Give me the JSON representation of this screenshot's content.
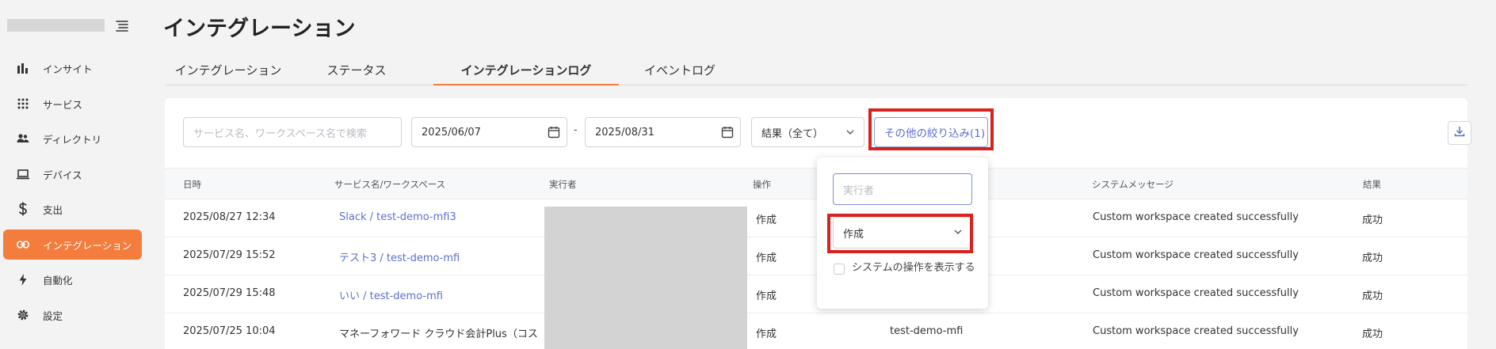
{
  "sidebar": {
    "items": [
      {
        "label": "インサイト",
        "icon": "bar-chart-icon"
      },
      {
        "label": "サービス",
        "icon": "grid-icon"
      },
      {
        "label": "ディレクトリ",
        "icon": "users-icon"
      },
      {
        "label": "デバイス",
        "icon": "laptop-icon"
      },
      {
        "label": "支出",
        "icon": "dollar-icon"
      },
      {
        "label": "インテグレーション",
        "icon": "link-icon"
      },
      {
        "label": "自動化",
        "icon": "lightning-icon"
      },
      {
        "label": "設定",
        "icon": "gear-icon"
      }
    ],
    "active_index": 5
  },
  "page": {
    "title": "インテグレーション"
  },
  "tabs": [
    {
      "label": "インテグレーション"
    },
    {
      "label": "ステータス"
    },
    {
      "label": "インテグレーションログ"
    },
    {
      "label": "イベントログ"
    }
  ],
  "active_tab": 2,
  "filters": {
    "search_placeholder": "サービス名、ワークスペース名で検索",
    "date_from": "2025/06/07",
    "date_separator": "-",
    "date_to": "2025/08/31",
    "result_select": "結果（全て）",
    "more_filters": "その他の絞り込み(1)"
  },
  "table": {
    "headers": {
      "datetime": "日時",
      "service": "サービス名/ワークスペース",
      "executor": "実行者",
      "operation": "操作",
      "message": "システムメッセージ",
      "result": "結果"
    },
    "rows": [
      {
        "datetime": "2025/08/27 12:34",
        "service": "Slack / test-demo-mfi3",
        "operation": "作成",
        "workspace": "",
        "message": "Custom workspace created successfully",
        "result": "成功"
      },
      {
        "datetime": "2025/07/29 15:52",
        "service": "テスト3 / test-demo-mfi",
        "operation": "作成",
        "workspace": "",
        "message": "Custom workspace created successfully",
        "result": "成功"
      },
      {
        "datetime": "2025/07/29 15:48",
        "service": "いい / test-demo-mfi",
        "operation": "作成",
        "workspace": "",
        "message": "Custom workspace created successfully",
        "result": "成功"
      },
      {
        "datetime": "2025/07/25 10:04",
        "service": "マネーフォワード クラウド会計Plus（コス",
        "operation": "作成",
        "workspace": "test-demo-mfi",
        "message": "Custom workspace created successfully",
        "result": "成功"
      }
    ]
  },
  "popover": {
    "executor_placeholder": "実行者",
    "operation_value": "作成",
    "show_system_label": "システムの操作を表示する"
  },
  "colors": {
    "accent": "#f47c3c",
    "link": "#5b6fd0",
    "highlight": "#d9211d"
  }
}
